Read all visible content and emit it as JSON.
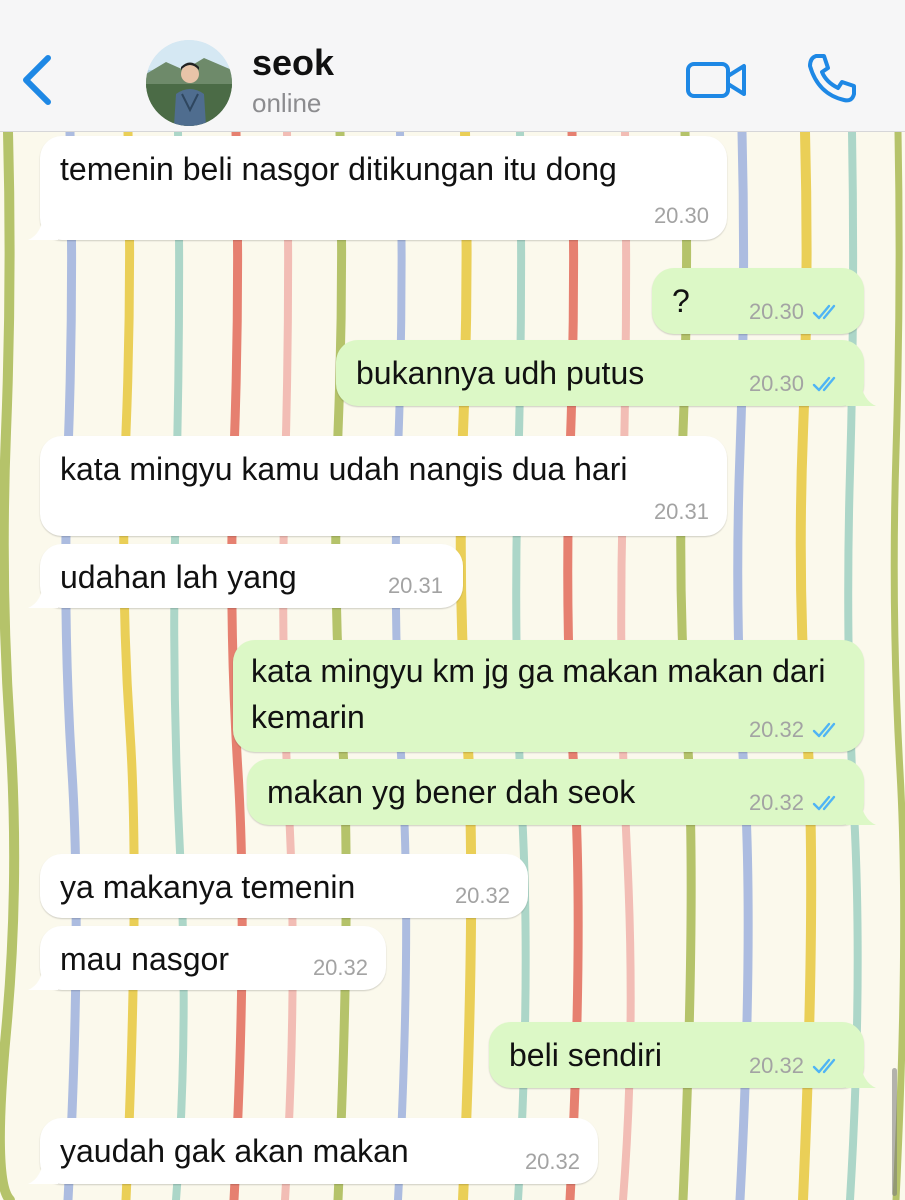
{
  "header": {
    "contact_name": "seok",
    "status": "online",
    "back_icon": "chevron-left-icon",
    "video_icon": "video-camera-icon",
    "call_icon": "phone-icon"
  },
  "colors": {
    "accent": "#1e88e5",
    "incoming_bubble": "#ffffff",
    "outgoing_bubble": "#dcf8c6",
    "read_check": "#4fb4f5",
    "wallpaper": "#fbf9ec"
  },
  "messages": [
    {
      "direction": "in",
      "text": "temenin beli nasgor ditikungan itu dong",
      "time": "20.30"
    },
    {
      "direction": "out",
      "text": "?",
      "time": "20.30",
      "read": true
    },
    {
      "direction": "out",
      "text": "bukannya udh putus",
      "time": "20.30",
      "read": true
    },
    {
      "direction": "in",
      "text": "kata mingyu kamu udah nangis dua hari",
      "time": "20.31"
    },
    {
      "direction": "in",
      "text": "udahan lah yang",
      "time": "20.31"
    },
    {
      "direction": "out",
      "text": "kata mingyu km jg ga makan makan dari kemarin",
      "time": "20.32",
      "read": true
    },
    {
      "direction": "out",
      "text": "makan yg bener dah seok",
      "time": "20.32",
      "read": true
    },
    {
      "direction": "in",
      "text": "ya makanya temenin",
      "time": "20.32"
    },
    {
      "direction": "in",
      "text": "mau nasgor",
      "time": "20.32"
    },
    {
      "direction": "out",
      "text": "beli sendiri",
      "time": "20.32",
      "read": true
    },
    {
      "direction": "in",
      "text": "yaudah gak akan makan",
      "time": "20.32"
    }
  ]
}
